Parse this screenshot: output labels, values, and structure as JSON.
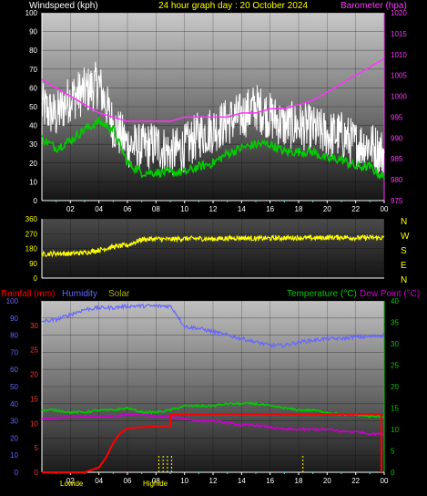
{
  "header": {
    "left_title": "Windspeed (kph)",
    "center_title": "24 hour graph day : 20 October 2024",
    "right_title": "Barometer (hpa)"
  },
  "bottom_header": {
    "rainfall": "Rainfall (mm)",
    "humidity": "Humidity",
    "solar": "Solar",
    "temperature": "Temperature (°C)",
    "dewpoint": "Dew Point (°C)"
  },
  "colors": {
    "wind": "#ffffff",
    "gust_avg": "#00cc00",
    "barometer": "#ff33ff",
    "direction": "#ffff00",
    "rain": "#ff0000",
    "humidity": "#6666ff",
    "solar": "#ffff00",
    "temperature": "#00cc00",
    "dewpoint": "#cc00cc",
    "hourtick": "#00ffff"
  },
  "direction_labels": [
    "N",
    "W",
    "S",
    "E",
    "N"
  ],
  "bottom_labels": [
    "Lowide",
    "Highide"
  ],
  "chart_data": [
    {
      "type": "line",
      "name": "wind",
      "x_ticks": [
        "02",
        "04",
        "06",
        "08",
        "10",
        "12",
        "14",
        "16",
        "18",
        "20",
        "22",
        "00"
      ],
      "y_ticks": [
        "0",
        "10",
        "20",
        "30",
        "40",
        "50",
        "60",
        "70",
        "80",
        "90",
        "100"
      ],
      "y2_ticks": [
        "975",
        "980",
        "985",
        "990",
        "995",
        "1000",
        "1005",
        "1010",
        "1015",
        "1020"
      ],
      "ylim": [
        0,
        100
      ],
      "y2lim": [
        975,
        1020
      ],
      "series": [
        {
          "name": "Windspeed (kph)",
          "x": [
            0,
            1,
            2,
            3,
            4,
            5,
            6,
            7,
            8,
            9,
            10,
            11,
            12,
            13,
            14,
            15,
            16,
            17,
            18,
            19,
            20,
            21,
            22,
            23,
            24
          ],
          "values": [
            50,
            45,
            55,
            58,
            62,
            40,
            30,
            28,
            30,
            25,
            28,
            35,
            38,
            42,
            45,
            50,
            45,
            40,
            40,
            38,
            35,
            35,
            30,
            30,
            25
          ]
        },
        {
          "name": "",
          "x": [
            0,
            1,
            2,
            3,
            4,
            5,
            6,
            7,
            8,
            9,
            10,
            11,
            12,
            13,
            14,
            15,
            16,
            17,
            18,
            19,
            20,
            21,
            22,
            23,
            24
          ],
          "values": [
            33,
            28,
            32,
            38,
            42,
            38,
            20,
            15,
            15,
            15,
            15,
            18,
            20,
            25,
            28,
            30,
            30,
            26,
            26,
            26,
            22,
            22,
            18,
            18,
            12
          ]
        },
        {
          "name": "Barometer (hpa)",
          "axis": "y2",
          "x": [
            0,
            1,
            2,
            3,
            4,
            5,
            6,
            7,
            8,
            9,
            10,
            11,
            12,
            13,
            14,
            15,
            16,
            17,
            18,
            19,
            20,
            21,
            22,
            23,
            24
          ],
          "values": [
            1004,
            1002,
            1000,
            998,
            996,
            995,
            994,
            994,
            994,
            994,
            995,
            995,
            995,
            995,
            996,
            996,
            997,
            997,
            998,
            999,
            1001,
            1003,
            1005,
            1007,
            1009
          ]
        }
      ]
    },
    {
      "type": "line",
      "name": "direction",
      "x_ticks": [],
      "y_ticks": [
        "0",
        "90",
        "180",
        "270",
        "360"
      ],
      "ylim": [
        0,
        360
      ],
      "series": [
        {
          "name": "",
          "x": [
            0,
            1,
            2,
            3,
            4,
            5,
            6,
            7,
            8,
            9,
            10,
            11,
            12,
            13,
            14,
            15,
            16,
            17,
            18,
            19,
            20,
            21,
            22,
            23,
            24
          ],
          "values": [
            145,
            150,
            148,
            155,
            170,
            190,
            200,
            235,
            238,
            235,
            240,
            240,
            238,
            242,
            245,
            240,
            242,
            244,
            245,
            243,
            246,
            248,
            244,
            246,
            244
          ]
        }
      ]
    },
    {
      "type": "line",
      "name": "climate",
      "x_ticks": [
        "02",
        "04",
        "06",
        "08",
        "10",
        "12",
        "14",
        "16",
        "18",
        "20",
        "22",
        "00"
      ],
      "y_ticks": [
        "0",
        "10",
        "20",
        "30",
        "40",
        "50",
        "60",
        "70",
        "80",
        "90",
        "100"
      ],
      "y_rain_ticks": [
        "0",
        "5",
        "10",
        "15",
        "20",
        "25",
        "30"
      ],
      "y_temp_ticks": [
        "0",
        "5",
        "10",
        "15",
        "20",
        "25",
        "30",
        "35",
        "40"
      ],
      "ylim": [
        0,
        100
      ],
      "y2lim": [
        0,
        40
      ],
      "series": [
        {
          "name": "Humidity",
          "x": [
            0,
            1,
            2,
            3,
            4,
            5,
            6,
            7,
            8,
            9,
            9.3,
            10,
            11,
            12,
            13,
            14,
            15,
            16,
            17,
            18,
            19,
            20,
            21,
            22,
            23,
            24
          ],
          "values": [
            88,
            89,
            92,
            95,
            96,
            96,
            97,
            97,
            97,
            97,
            94,
            85,
            84,
            82,
            80,
            78,
            76,
            74,
            74,
            76,
            77,
            78,
            78,
            79,
            79,
            80
          ]
        },
        {
          "name": "Rainfall (mm)",
          "axis": "rain",
          "x": [
            0,
            1,
            2,
            3,
            4,
            4.5,
            5,
            5.5,
            6,
            7,
            8,
            9,
            9,
            10,
            12,
            14,
            16,
            18,
            20,
            22,
            23.8,
            23.8
          ],
          "values": [
            0,
            0,
            0,
            0,
            1,
            3,
            6,
            8,
            9,
            9.2,
            9.4,
            9.5,
            11.7,
            11.8,
            11.9,
            11.9,
            11.9,
            11.9,
            11.9,
            11.9,
            11.9,
            0
          ]
        },
        {
          "name": "Temperature (°C)",
          "axis": "temp",
          "x": [
            0,
            1,
            2,
            3,
            4,
            5,
            6,
            7,
            8,
            9,
            10,
            11,
            12,
            13,
            14,
            15,
            16,
            17,
            18,
            19,
            20,
            21,
            22,
            23,
            24
          ],
          "values": [
            14.5,
            14.5,
            14,
            14,
            14.5,
            14.5,
            15,
            14,
            14,
            14.5,
            15.5,
            15.5,
            15.5,
            16,
            16,
            16,
            15.5,
            15,
            14.5,
            14.5,
            14,
            13.5,
            13.5,
            13,
            13
          ]
        },
        {
          "name": "Dew Point (°C)",
          "axis": "temp",
          "x": [
            0,
            1,
            2,
            3,
            4,
            5,
            6,
            7,
            8,
            9,
            10,
            11,
            12,
            13,
            14,
            15,
            16,
            17,
            18,
            19,
            20,
            21,
            22,
            23,
            24
          ],
          "values": [
            12.5,
            12.5,
            13,
            13,
            13,
            13,
            13.5,
            13.5,
            13,
            13,
            12.5,
            12,
            12,
            11.5,
            11,
            11,
            10.5,
            10,
            10,
            10,
            10,
            9.5,
            9.5,
            9,
            9
          ]
        }
      ],
      "solar_x": [
        8.2,
        8.5,
        8.8,
        9.1,
        18.3
      ]
    }
  ]
}
